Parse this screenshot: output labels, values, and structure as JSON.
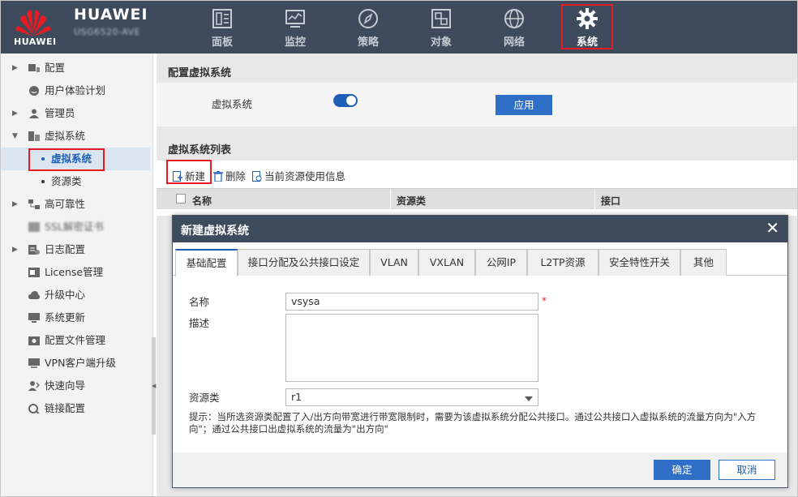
{
  "header": {
    "brand": "HUAWEI",
    "logo_text": "HUAWEI",
    "model": "USG6520-AVE",
    "nav": [
      {
        "label": "面板",
        "icon": "dashboard-icon"
      },
      {
        "label": "监控",
        "icon": "monitor-icon"
      },
      {
        "label": "策略",
        "icon": "compass-icon"
      },
      {
        "label": "对象",
        "icon": "object-icon"
      },
      {
        "label": "网络",
        "icon": "globe-icon"
      },
      {
        "label": "系统",
        "icon": "gear-icon",
        "active": true
      }
    ]
  },
  "sidebar": {
    "items": [
      {
        "label": "配置",
        "icon": "config-icon",
        "expandable": true
      },
      {
        "label": "用户体验计划",
        "icon": "smile-icon"
      },
      {
        "label": "管理员",
        "icon": "user-icon",
        "expandable": true
      },
      {
        "label": "虚拟系统",
        "icon": "vsys-icon",
        "expanded": true
      },
      {
        "label": "虚拟系统",
        "sub": true,
        "selected": true
      },
      {
        "label": "资源类",
        "sub": true
      },
      {
        "label": "高可靠性",
        "icon": "ha-icon",
        "expandable": true
      },
      {
        "label": "SSL解密证书",
        "icon": "cert-icon",
        "blurred": true
      },
      {
        "label": "日志配置",
        "icon": "log-icon",
        "expandable": true
      },
      {
        "label": "License管理",
        "icon": "license-icon"
      },
      {
        "label": "升级中心",
        "icon": "cloud-icon"
      },
      {
        "label": "系统更新",
        "icon": "update-icon"
      },
      {
        "label": "配置文件管理",
        "icon": "file-icon"
      },
      {
        "label": "VPN客户端升级",
        "icon": "vpn-icon"
      },
      {
        "label": "快速向导",
        "icon": "wizard-icon"
      },
      {
        "label": "链接配置",
        "icon": "link-icon"
      }
    ]
  },
  "main": {
    "config_title": "配置虚拟系统",
    "vsys_label": "虚拟系统",
    "vsys_enabled": true,
    "apply_label": "应用",
    "list_title": "虚拟系统列表",
    "toolbar": {
      "new": "新建",
      "delete": "删除",
      "resource_info": "当前资源使用信息"
    },
    "columns": [
      "名称",
      "资源类",
      "接口"
    ]
  },
  "modal": {
    "title": "新建虚拟系统",
    "close": "✕",
    "tabs": [
      "基础配置",
      "接口分配及公共接口设定",
      "VLAN",
      "VXLAN",
      "公网IP",
      "L2TP资源",
      "安全特性开关",
      "其他"
    ],
    "active_tab": "基础配置",
    "fields": {
      "name_label": "名称",
      "name_value": "vsysa",
      "required_mark": "*",
      "desc_label": "描述",
      "desc_value": "",
      "resource_label": "资源类",
      "resource_value": "r1"
    },
    "hint": "提示：当所选资源类配置了入/出方向带宽进行带宽限制时，需要为该虚拟系统分配公共接口。通过公共接口入虚拟系统的流量方向为\"入方向\"；通过公共接口出虚拟系统的流量为\"出方向\"",
    "ok": "确定",
    "cancel": "取消"
  },
  "colors": {
    "header_bg": "#3e4b5c",
    "accent": "#2f6fc8",
    "highlight": "#e51c23"
  }
}
